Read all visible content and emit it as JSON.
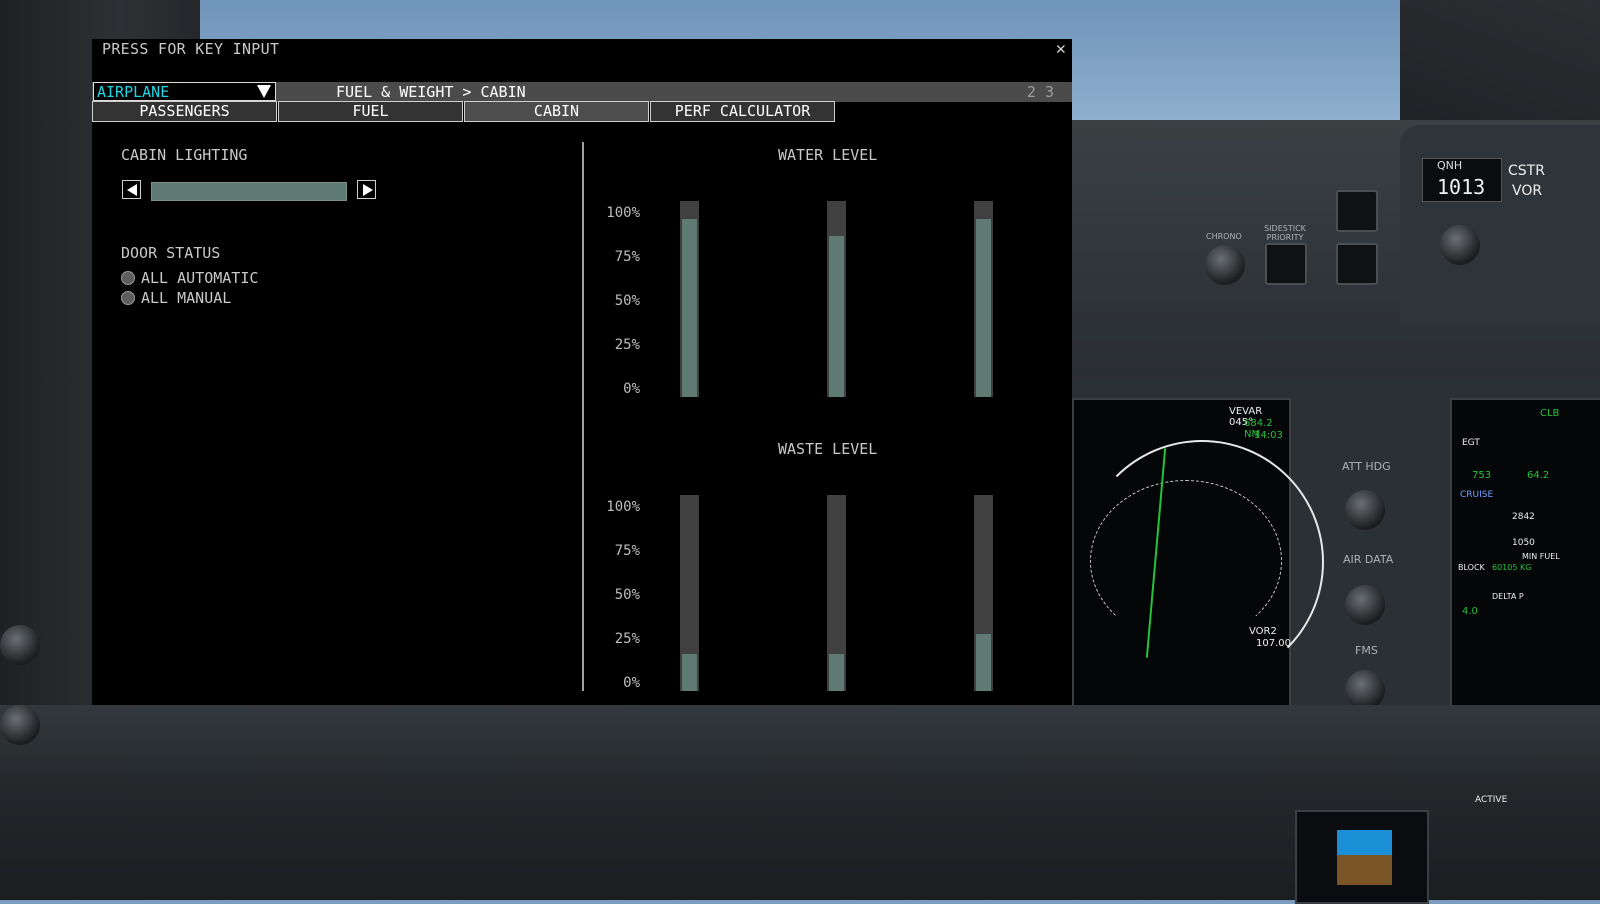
{
  "dialog": {
    "title": "PRESS FOR KEY INPUT",
    "close_symbol": "✕",
    "dropdown": {
      "value": "AIRPLANE"
    },
    "breadcrumb": "FUEL & WEIGHT > CABIN",
    "pages": "2 3",
    "tabs": [
      {
        "label": "PASSENGERS"
      },
      {
        "label": "FUEL"
      },
      {
        "label": "CABIN"
      },
      {
        "label": "PERF CALCULATOR"
      }
    ]
  },
  "cabin_lighting": {
    "label": "CABIN LIGHTING",
    "level": 1.0
  },
  "door_status": {
    "label": "DOOR STATUS",
    "options": [
      {
        "label": "ALL AUTOMATIC"
      },
      {
        "label": "ALL MANUAL"
      }
    ]
  },
  "water_level": {
    "title": "WATER LEVEL",
    "ticks": [
      "100%",
      "75%",
      "50%",
      "25%",
      "0%"
    ],
    "tanks_percent": [
      91,
      82,
      91
    ]
  },
  "waste_level": {
    "title": "WASTE LEVEL",
    "ticks": [
      "100%",
      "75%",
      "50%",
      "25%",
      "0%"
    ],
    "tanks_percent": [
      19,
      19,
      29
    ]
  },
  "colors": {
    "dropdown_text": "#1fd5e6",
    "gauge_fill": "#5f7a72",
    "gauge_empty": "#404040"
  },
  "background": {
    "qnh_label": "QNH",
    "qnh_value": "1013",
    "cstr": "CSTR",
    "vor": "VOR",
    "att_hdg": "ATT HDG",
    "air_data": "AIR DATA",
    "fms": "FMS",
    "chrono": "CHRONO",
    "sidestick": "SIDESTICK PRIORITY",
    "nd_waypoint": "VEVAR 045°",
    "nd_distance": "684.2 NM",
    "nd_time": "14:03",
    "nd_vor2": "VOR2",
    "nd_vor2_freq": "107.00",
    "ed_clb": "CLB",
    "ed_egt": "EGT",
    "ed_egt_val": "753",
    "ed_n1": "64.2",
    "ed_cruise": "CRUISE",
    "ed_fuel1": "2842",
    "ed_fuel2": "1050",
    "ed_block": "BLOCK",
    "ed_block_val": "60105 KG",
    "ed_min_fuel": "MIN FUEL",
    "ed_delta_p": "DELTA P",
    "ed_psi": "4.0",
    "pfd_mode": "ACTIVE"
  }
}
